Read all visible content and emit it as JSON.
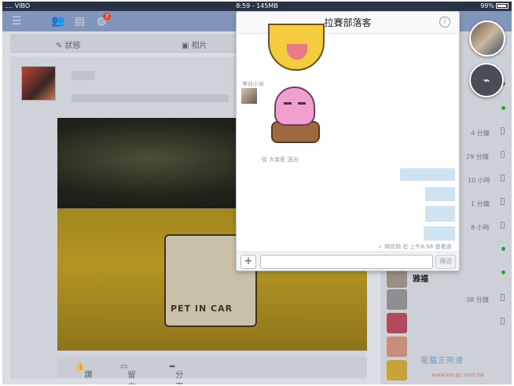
{
  "status_bar": {
    "carrier": "....  VIBO",
    "time_title": "8:59 - 145MB",
    "battery": "99%"
  },
  "fb_nav": {
    "menu_icon": "hamburger-icon",
    "friends_icon": "friends-icon",
    "messages_icon": "messages-icon",
    "notifications_icon": "globe-icon",
    "notification_count": "7"
  },
  "composer": {
    "status_label": "狀態",
    "photo_label": "相片"
  },
  "post": {
    "sticker_text": "PET IN CAR",
    "actions": {
      "like": "讚",
      "comment": "留言",
      "share": "分享"
    }
  },
  "sidebar": {
    "times": [
      "4 分鐘",
      "29 分鐘",
      "10 小時",
      "1 分鐘",
      "8 小時",
      "38 分鐘"
    ],
    "name_partial": "雅福"
  },
  "chat": {
    "title": "拉賽部落客",
    "info_icon": "info-icon",
    "sender_name": "李兆小米",
    "sticker_caption": "從 大妄匪 送出",
    "seen_receipt": "林信旭 在 上午8:58 查看過",
    "input_placeholder": "",
    "send_label": "傳送",
    "plus_label": "+"
  },
  "watermark": {
    "text": "電腦王阿達",
    "url": "www.kocpc.com.tw"
  },
  "colors": {
    "fb_blue": "#3b5998",
    "bubble_blue": "#cfe3f3",
    "online_green": "#2e9e3e"
  }
}
